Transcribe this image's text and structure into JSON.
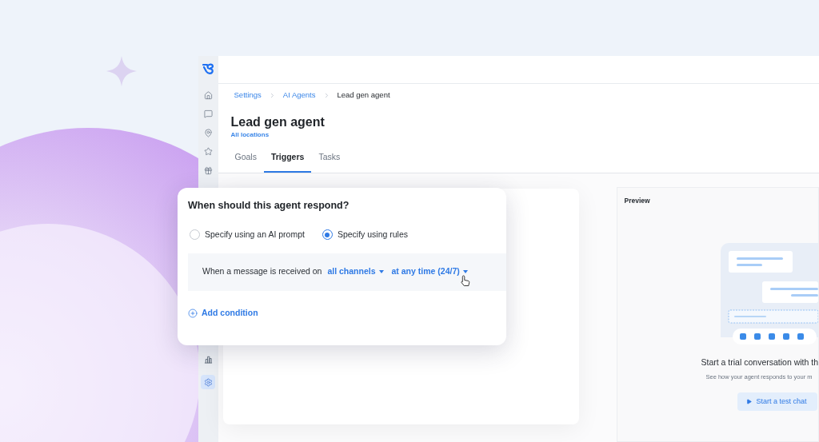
{
  "sidebar": {
    "items": [
      {
        "selected": false
      },
      {
        "selected": false
      },
      {
        "selected": false
      },
      {
        "selected": false
      },
      {
        "selected": false
      },
      {
        "selected": false
      },
      {
        "selected": true
      }
    ]
  },
  "breadcrumb": [
    "Settings",
    "AI Agents",
    "Lead gen agent"
  ],
  "page": {
    "title": "Lead gen agent",
    "subtitle": "All locations"
  },
  "tabs": [
    {
      "label": "Goals",
      "selected": false
    },
    {
      "label": "Triggers",
      "selected": true
    },
    {
      "label": "Tasks",
      "selected": false
    }
  ],
  "dialog": {
    "title": "When should this agent respond?",
    "options": [
      {
        "label": "Specify using an AI prompt",
        "selected": false
      },
      {
        "label": "Specify using rules",
        "selected": true
      }
    ],
    "condition": {
      "text": "When a message is received on",
      "dropdowns": [
        "all channels",
        "at any time (24/7)"
      ]
    },
    "add_button": "Add condition"
  },
  "preview": {
    "title": "Preview",
    "heading": "Start a trial conversation with th",
    "subtext": "See how your agent responds to your m",
    "button": "Start a test chat"
  }
}
